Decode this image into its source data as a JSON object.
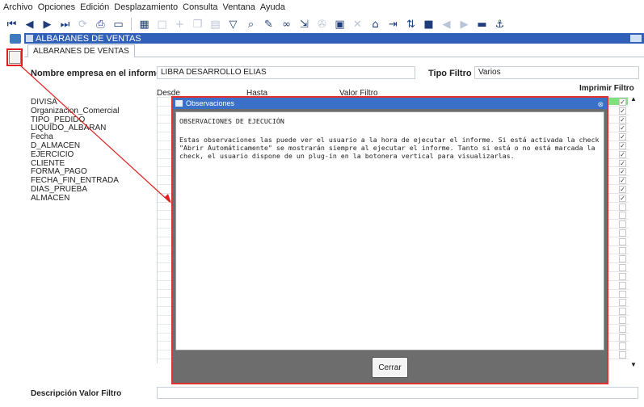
{
  "menu": [
    "Archivo",
    "Opciones",
    "Edición",
    "Desplazamiento",
    "Consulta",
    "Ventana",
    "Ayuda"
  ],
  "window": {
    "title": "ALBARANES DE VENTAS"
  },
  "tab": {
    "label": "ALBARANES DE VENTAS"
  },
  "form": {
    "company_label": "Nombre empresa en el informe",
    "company_value": "LIBRA DESARROLLO ELIAS",
    "filter_type_label": "Tipo Filtro",
    "filter_type_value": "Varios",
    "print_filter_label": "Imprimir Filtro",
    "col_desde": "Desde",
    "col_hasta": "Hasta",
    "col_valor": "Valor Filtro",
    "description_label": "Descripción Valor Filtro"
  },
  "rows": [
    "DIVISA",
    "Organizacion_Comercial",
    "TIPO_PEDIDO",
    "LIQUIDO_ALBARAN",
    "Fecha",
    "D_ALMACEN",
    "EJERCICIO",
    "CLIENTE",
    "FORMA_PAGO",
    "FECHA_FIN_ENTRADA",
    "DIAS_PRUEBA",
    "ALMACEN"
  ],
  "dialog": {
    "title": "Observaciones",
    "heading": "OBSERVACIONES DE EJECUCIÓN",
    "message": "Estas observaciones las puede ver el usuario a la hora de ejecutar el informe. Si está activada la check\n\"Abrir Automáticamente\" se mostrarán siempre al ejecutar el informe. Tanto si está o no está marcada la\ncheck, el usuario dispone de un plug-in en la botonera vertical para visualizarlas.",
    "close_label": "Cerrar"
  },
  "colors": {
    "titlebar": "#3060b8",
    "highlight": "#e03030",
    "green_row": "#7fe07f"
  }
}
